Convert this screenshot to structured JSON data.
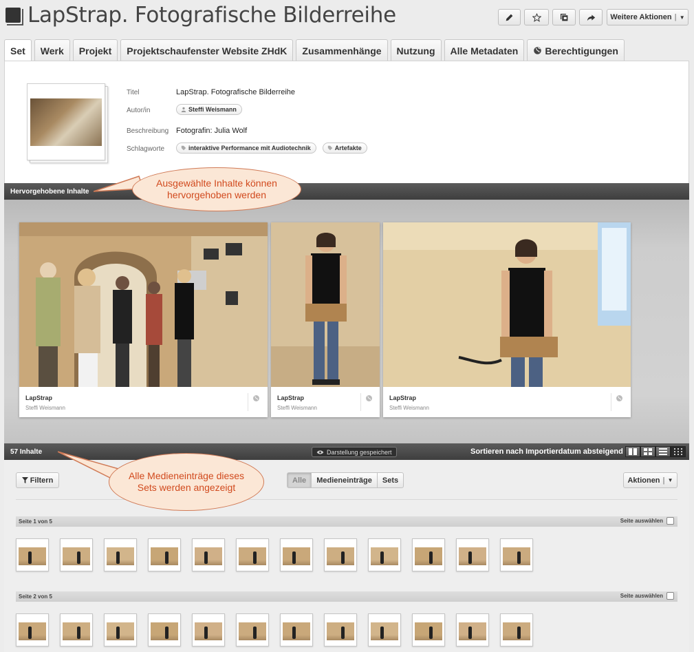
{
  "header": {
    "title": "LapStrap. Fotografische Bilderreihe",
    "more_actions_label": "Weitere Aktionen",
    "icons": [
      "pencil-icon",
      "star-icon",
      "stack-icon",
      "share-icon"
    ]
  },
  "tabs": [
    {
      "label": "Set",
      "active": true
    },
    {
      "label": "Werk"
    },
    {
      "label": "Projekt"
    },
    {
      "label": "Projektschaufenster Website ZHdK"
    },
    {
      "label": "Zusammenhänge"
    },
    {
      "label": "Nutzung"
    },
    {
      "label": "Alle Metadaten"
    },
    {
      "label": "Berechtigungen",
      "icon": "globe-icon"
    }
  ],
  "meta": {
    "title_label": "Titel",
    "title_value": "LapStrap. Fotografische Bilderreihe",
    "author_label": "Autor/in",
    "author_value": "Steffi Weismann",
    "desc_label": "Beschreibung",
    "desc_value": "Fotografin: Julia Wolf",
    "keywords_label": "Schlagworte",
    "keywords": [
      "interaktive Performance mit Audiotechnik",
      "Artefakte"
    ]
  },
  "featured": {
    "bar_label": "Hervorgehobene Inhalte",
    "cards": [
      {
        "title": "LapStrap",
        "author": "Steffi Weismann"
      },
      {
        "title": "LapStrap",
        "author": "Steffi Weismann"
      },
      {
        "title": "LapStrap",
        "author": "Steffi Weismann"
      }
    ]
  },
  "callouts": {
    "featured": "Ausgewählte Inhalte können hervorgehoben werden",
    "all_items": "Alle Medieneinträge dieses Sets werden angezeigt"
  },
  "list_bar": {
    "count_label": "57 Inhalte",
    "saved_label": "Darstellung gespeichert",
    "sort_label": "Sortieren nach Importierdatum absteigend"
  },
  "filters": {
    "filter_label": "Filtern",
    "segments": [
      "Alle",
      "Medieneinträge",
      "Sets"
    ],
    "actions_label": "Aktionen"
  },
  "pages": [
    {
      "label": "Seite 1 von 5",
      "select_label": "Seite auswählen"
    },
    {
      "label": "Seite 2 von 5",
      "select_label": "Seite auswählen"
    }
  ],
  "colors": {
    "accent_callout": "#d14a1e",
    "bar_dark": "#4a4a4a"
  }
}
